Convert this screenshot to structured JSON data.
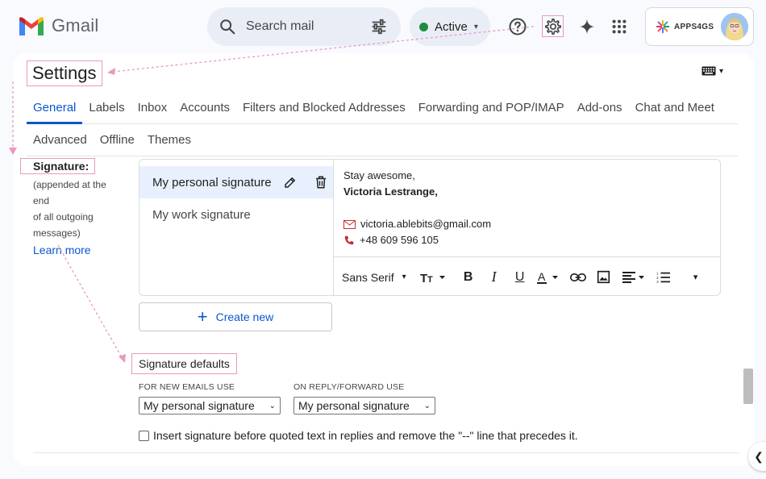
{
  "brand": {
    "name": "Gmail"
  },
  "search": {
    "placeholder": "Search mail"
  },
  "status": {
    "label": "Active",
    "color": "#1e8e3e"
  },
  "account": {
    "brand": "APPS4GS"
  },
  "settings": {
    "title": "Settings",
    "tabs_row1": [
      "General",
      "Labels",
      "Inbox",
      "Accounts",
      "Filters and Blocked Addresses",
      "Forwarding and POP/IMAP",
      "Add-ons",
      "Chat and Meet"
    ],
    "tabs_row2": [
      "Advanced",
      "Offline",
      "Themes"
    ],
    "active_tab": "General"
  },
  "signature": {
    "label": "Signature:",
    "description_lines": [
      "(appended at the end",
      "of all outgoing",
      "messages)"
    ],
    "learn_more": "Learn more",
    "items": [
      "My personal signature",
      "My work signature"
    ],
    "content": {
      "line1": "Stay awesome,",
      "line2": "Victoria Lestrange,",
      "email": "victoria.ablebits@gmail.com",
      "phone": "+48 609 596 105"
    },
    "toolbar": {
      "font": "Sans Serif"
    },
    "create_new": "Create new"
  },
  "defaults": {
    "title": "Signature defaults",
    "new_label": "FOR NEW EMAILS USE",
    "new_value": "My personal signature",
    "reply_label": "ON REPLY/FORWARD USE",
    "reply_value": "My personal signature",
    "insert_text": "Insert signature before quoted text in replies and remove the \"--\" line that precedes it."
  },
  "colors": {
    "accent": "#0b57d0",
    "annotation": "#e89ac0",
    "background": "#f8fafd"
  }
}
